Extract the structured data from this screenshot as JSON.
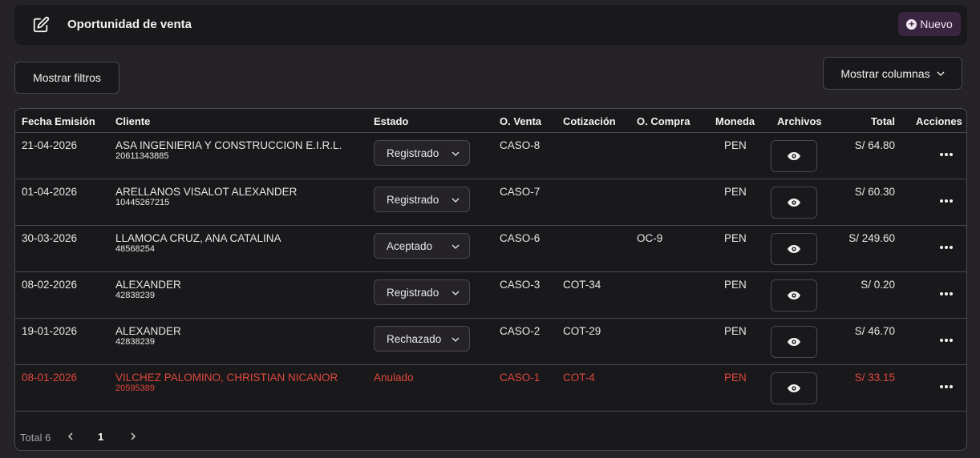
{
  "header": {
    "title": "Oportunidad de venta",
    "new_label": "Nuevo"
  },
  "toolbar": {
    "filters_label": "Mostrar filtros",
    "columns_label": "Mostrar columnas"
  },
  "table": {
    "columns": [
      "Fecha Emisión",
      "Cliente",
      "Estado",
      "O. Venta",
      "Cotización",
      "O. Compra",
      "Moneda",
      "Archivos",
      "Total",
      "Acciones"
    ],
    "rows": [
      {
        "fecha": "21-04-2026",
        "cliente": "ASA INGENIERIA Y CONSTRUCCION E.I.R.L.",
        "doc": "20611343885",
        "estado": "Registrado",
        "o_venta": "CASO-8",
        "cotizacion": "",
        "o_compra": "",
        "moneda": "PEN",
        "total": "S/ 64.80",
        "anulado": false
      },
      {
        "fecha": "01-04-2026",
        "cliente": "ARELLANOS VISALOT ALEXANDER",
        "doc": "10445267215",
        "estado": "Registrado",
        "o_venta": "CASO-7",
        "cotizacion": "",
        "o_compra": "",
        "moneda": "PEN",
        "total": "S/ 60.30",
        "anulado": false
      },
      {
        "fecha": "30-03-2026",
        "cliente": "LLAMOCA CRUZ, ANA CATALINA",
        "doc": "48568254",
        "estado": "Aceptado",
        "o_venta": "CASO-6",
        "cotizacion": "",
        "o_compra": "OC-9",
        "moneda": "PEN",
        "total": "S/ 249.60",
        "anulado": false
      },
      {
        "fecha": "08-02-2026",
        "cliente": "ALEXANDER",
        "doc": "42838239",
        "estado": "Registrado",
        "o_venta": "CASO-3",
        "cotizacion": "COT-34",
        "o_compra": "",
        "moneda": "PEN",
        "total": "S/ 0.20",
        "anulado": false
      },
      {
        "fecha": "19-01-2026",
        "cliente": "ALEXANDER",
        "doc": "42838239",
        "estado": "Rechazado",
        "o_venta": "CASO-2",
        "cotizacion": "COT-29",
        "o_compra": "",
        "moneda": "PEN",
        "total": "S/ 46.70",
        "anulado": false
      },
      {
        "fecha": "08-01-2026",
        "cliente": "VILCHEZ PALOMINO, CHRISTIAN NICANOR",
        "doc": "20595389",
        "estado": "Anulado",
        "o_venta": "CASO-1",
        "cotizacion": "COT-4",
        "o_compra": "",
        "moneda": "PEN",
        "total": "S/ 33.15",
        "anulado": true
      }
    ]
  },
  "pagination": {
    "total_label": "Total 6",
    "current_page": "1"
  },
  "icons": {
    "edit": "edit-icon",
    "add": "plus-circle-icon",
    "chevron": "chevron-down-icon",
    "view": "eye-icon",
    "more": "dots-horizontal-icon"
  },
  "colors": {
    "background": "#252328",
    "panel": "#19181b",
    "border": "#4a484d",
    "accent": "#3a2540",
    "cancelled": "#e0483c"
  }
}
